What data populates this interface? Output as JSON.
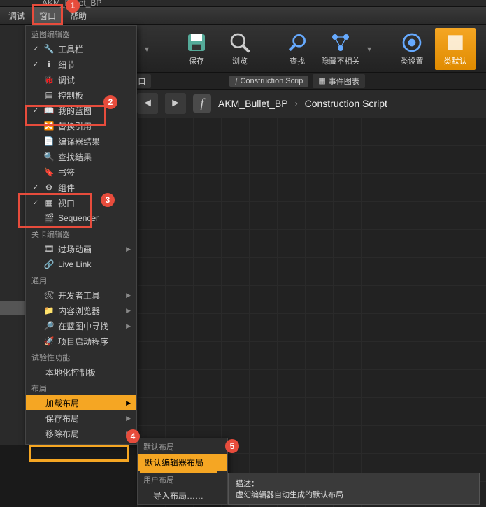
{
  "title_remnant": "AKM_Bullet_BP",
  "menubar": {
    "debug": "调试",
    "window": "窗口",
    "help": "帮助"
  },
  "toolbar": {
    "save": "保存",
    "browse": "浏览",
    "find": "查找",
    "hide": "隐藏不相关",
    "settings": "类设置",
    "defaults": "类默认"
  },
  "tabs": {
    "viewport": "口",
    "construction": "Construction Scrip",
    "events": "事件图表"
  },
  "breadcrumb": {
    "item1": "AKM_Bullet_BP",
    "item2": "Construction Script"
  },
  "dropdown": {
    "sec_bp_editor": "蓝图编辑器",
    "toolbar": "工具栏",
    "detail": "细节",
    "debug": "调试",
    "panel": "控制板",
    "mybp": "我的蓝图",
    "switch": "替换引用",
    "compile": "编译器结果",
    "findres": "查找结果",
    "bookmark": "书签",
    "component": "组件",
    "viewport": "视口",
    "sequencer": "Sequencer",
    "sec_level": "关卡编辑器",
    "cutscene": "过场动画",
    "livelink": "Live Link",
    "sec_common": "通用",
    "devtools": "开发者工具",
    "content": "内容浏览器",
    "findinbp": "在蓝图中寻找",
    "launcher": "项目启动程序",
    "sec_exp": "试验性功能",
    "localpanel": "本地化控制板",
    "sec_layout": "布局",
    "loadlayout": "加载布局",
    "savelayout": "保存布局",
    "removelayout": "移除布局"
  },
  "submenu": {
    "sec_default": "默认布局",
    "default_editor": "默认编辑器布局",
    "sec_user": "用户布局",
    "import": "导入布局……"
  },
  "tooltip": {
    "desc_label": "描述：",
    "desc_text": "虚幻编辑器自动生成的默认布局"
  },
  "callouts": {
    "c1": "1",
    "c2": "2",
    "c3": "3",
    "c4": "4",
    "c5": "5"
  }
}
